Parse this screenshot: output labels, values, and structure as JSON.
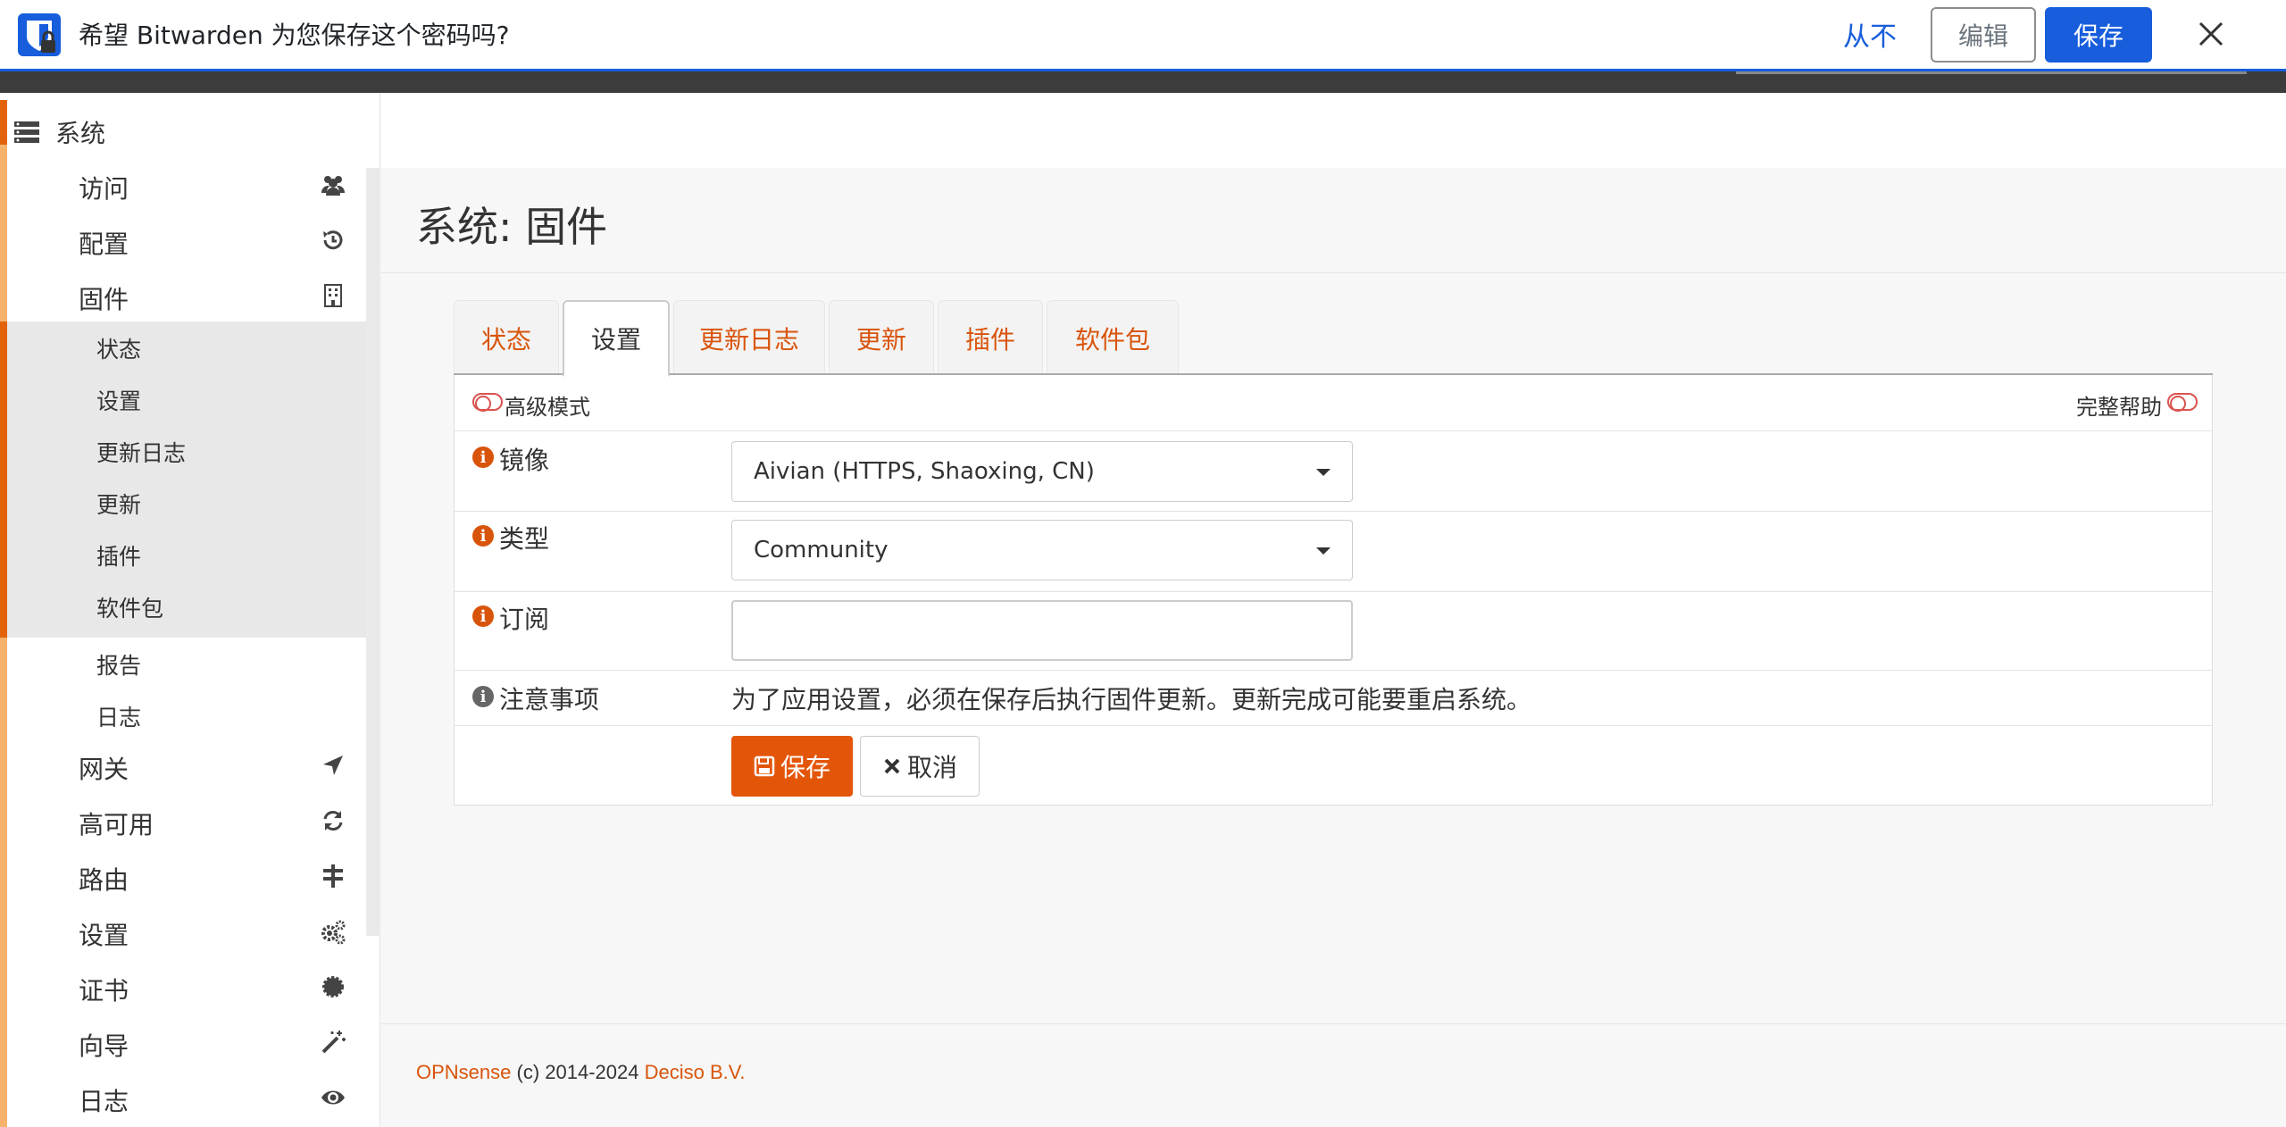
{
  "bitwarden": {
    "message": "希望 Bitwarden 为您保存这个密码吗?",
    "never": "从不",
    "edit": "编辑",
    "save": "保存"
  },
  "sidebar": {
    "section": "系统",
    "items": [
      {
        "label": "访问",
        "icon": "users-icon"
      },
      {
        "label": "配置",
        "icon": "history-icon"
      },
      {
        "label": "固件",
        "icon": "building-icon"
      }
    ],
    "firmware_sub": [
      "状态",
      "设置",
      "更新日志",
      "更新",
      "插件",
      "软件包"
    ],
    "after_sub": [
      "报告",
      "日志"
    ],
    "bottom_items": [
      {
        "label": "网关",
        "icon": "location-arrow-icon"
      },
      {
        "label": "高可用",
        "icon": "refresh-icon"
      },
      {
        "label": "路由",
        "icon": "signpost-icon"
      },
      {
        "label": "设置",
        "icon": "cogs-icon"
      },
      {
        "label": "证书",
        "icon": "certificate-icon"
      },
      {
        "label": "向导",
        "icon": "magic-wand-icon"
      },
      {
        "label": "日志",
        "icon": "eye-icon"
      }
    ]
  },
  "page": {
    "title": "系统: 固件"
  },
  "tabs": [
    "状态",
    "设置",
    "更新日志",
    "更新",
    "插件",
    "软件包"
  ],
  "active_tab": "设置",
  "form": {
    "advanced_mode": "高级模式",
    "full_help": "完整帮助",
    "mirror_label": "镜像",
    "mirror_value": "Aivian (HTTPS, Shaoxing, CN)",
    "type_label": "类型",
    "type_value": "Community",
    "subscription_label": "订阅",
    "subscription_value": "",
    "notes_label": "注意事项",
    "notes_text": "为了应用设置，必须在保存后执行固件更新。更新完成可能要重启系统。",
    "save_button": "保存",
    "cancel_button": "取消"
  },
  "footer": {
    "brand": "OPNsense",
    "copyright": "(c) 2014-2024",
    "company": "Deciso B.V."
  },
  "colors": {
    "bitwarden_blue": "#175ddc",
    "opnsense_orange": "#d9540b",
    "sidebar_accent": "#e3630a"
  }
}
